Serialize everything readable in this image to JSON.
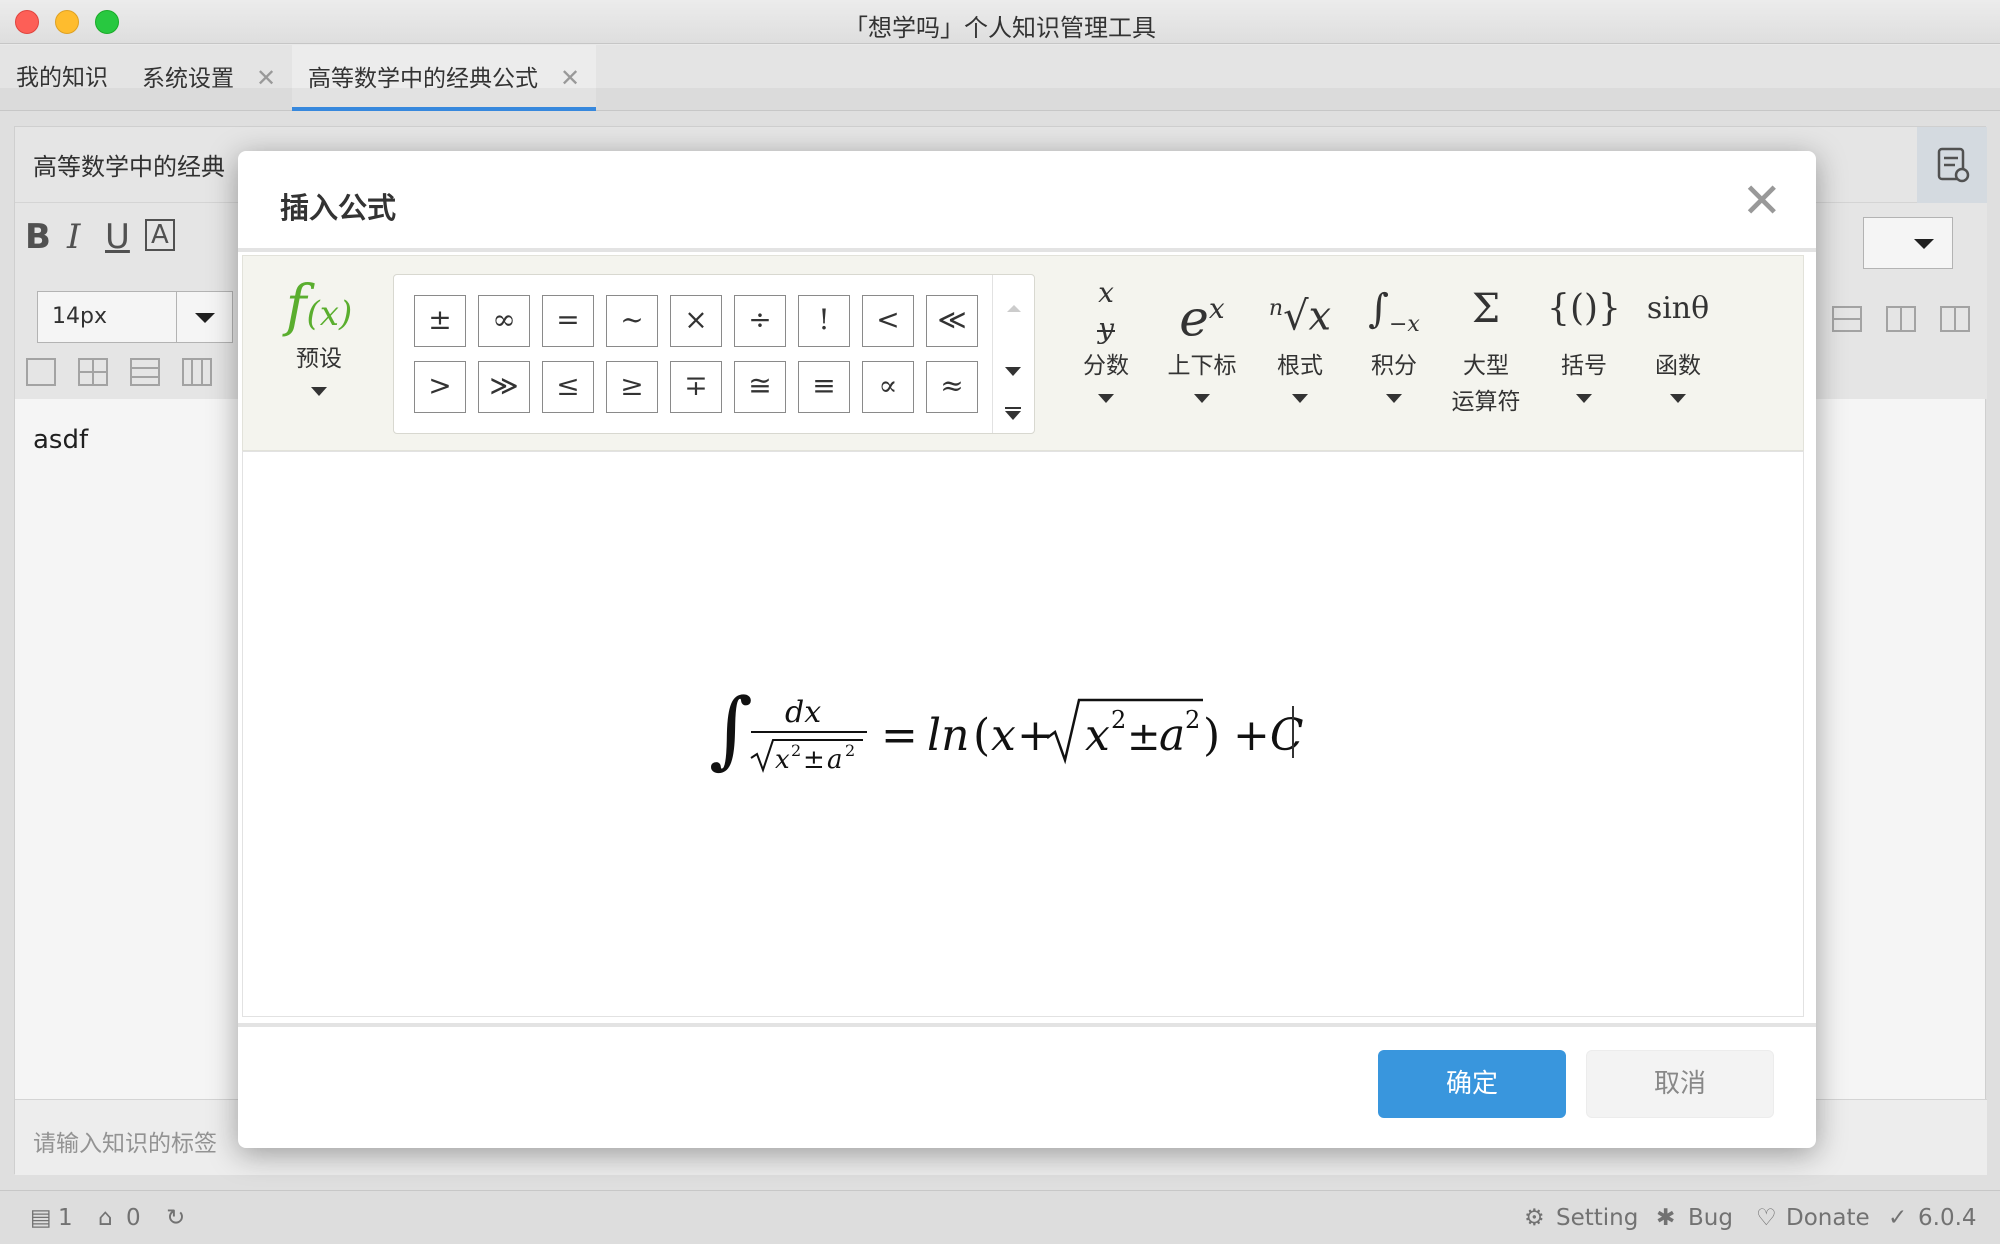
{
  "window": {
    "title": "「想学吗」个人知识管理工具"
  },
  "tabs": [
    {
      "label": "我的知识",
      "closable": false
    },
    {
      "label": "系统设置",
      "closable": true
    },
    {
      "label": "高等数学中的经典公式",
      "closable": true,
      "active": true
    }
  ],
  "editor": {
    "doc_title": "高等数学中的经典",
    "font_size": "14px",
    "content": "asdf",
    "tag_placeholder": "请输入知识的标签"
  },
  "statusbar": {
    "doc_count": "1",
    "tag_count": "0",
    "setting": "Setting",
    "bug": "Bug",
    "donate": "Donate",
    "version": "6.0.4"
  },
  "modal": {
    "title": "插入公式",
    "preset_label": "预设",
    "symbols_row1": [
      "±",
      "∞",
      "=",
      "~",
      "×",
      "÷",
      "!",
      "<",
      "≪"
    ],
    "symbols_row2": [
      ">",
      "≫",
      "≤",
      "≥",
      "∓",
      "≅",
      "≡",
      "∝",
      "≈"
    ],
    "tools": [
      {
        "label": "分数",
        "icon": "fraction-icon"
      },
      {
        "label": "上下标",
        "icon": "script-icon"
      },
      {
        "label": "根式",
        "icon": "radical-icon"
      },
      {
        "label": "积分",
        "icon": "integral-icon"
      },
      {
        "label": "大型",
        "label2": "运算符",
        "icon": "large-operator-icon"
      },
      {
        "label": "括号",
        "icon": "bracket-icon"
      },
      {
        "label": "函数",
        "icon": "function-icon"
      }
    ],
    "formula": {
      "numerator": "dx",
      "equals": "=",
      "ln": "ln",
      "rhs_const": "+C",
      "pm": "±",
      "x": "x",
      "a": "a",
      "exp": "2",
      "plus": "+"
    },
    "ok": "确定",
    "cancel": "取消"
  },
  "colors": {
    "accent": "#3996dd",
    "preset_green": "#5aae2e"
  }
}
